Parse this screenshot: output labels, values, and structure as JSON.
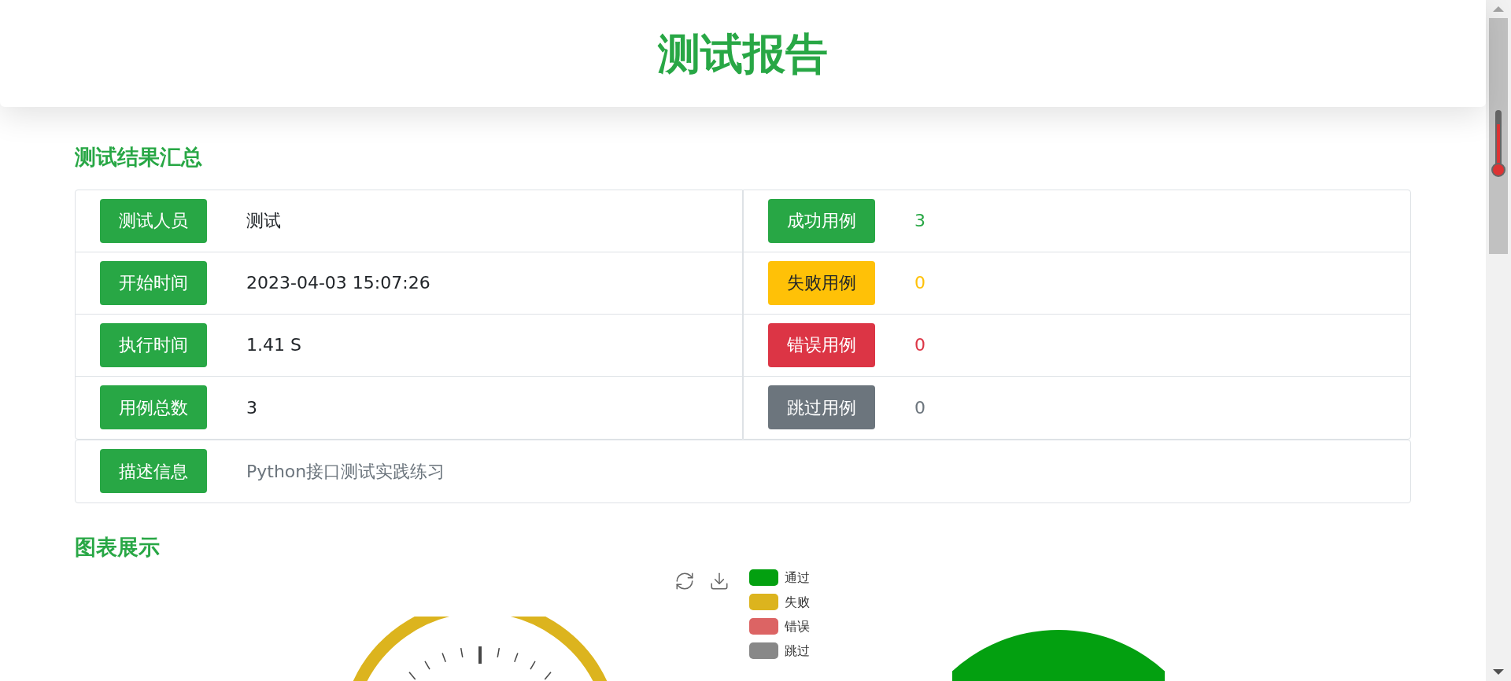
{
  "header": {
    "title": "测试报告"
  },
  "summary": {
    "heading": "测试结果汇总",
    "left_rows": [
      {
        "label": "测试人员",
        "value": "测试",
        "kind": "success"
      },
      {
        "label": "开始时间",
        "value": "2023-04-03 15:07:26",
        "kind": "success"
      },
      {
        "label": "执行时间",
        "value": "1.41 S",
        "kind": "success"
      },
      {
        "label": "用例总数",
        "value": "3",
        "kind": "success"
      }
    ],
    "right_rows": [
      {
        "label": "成功用例",
        "value": "3",
        "kind": "success"
      },
      {
        "label": "失败用例",
        "value": "0",
        "kind": "warning"
      },
      {
        "label": "错误用例",
        "value": "0",
        "kind": "danger"
      },
      {
        "label": "跳过用例",
        "value": "0",
        "kind": "secondary"
      }
    ],
    "description": {
      "label": "描述信息",
      "value": "Python接口测试实践练习",
      "kind": "success"
    }
  },
  "charts": {
    "heading": "图表展示",
    "legend": [
      {
        "label": "通过",
        "color": "#03a010"
      },
      {
        "label": "失败",
        "color": "#dcb41e"
      },
      {
        "label": "错误",
        "color": "#dc6464"
      },
      {
        "label": "跳过",
        "color": "#888888"
      }
    ]
  }
}
